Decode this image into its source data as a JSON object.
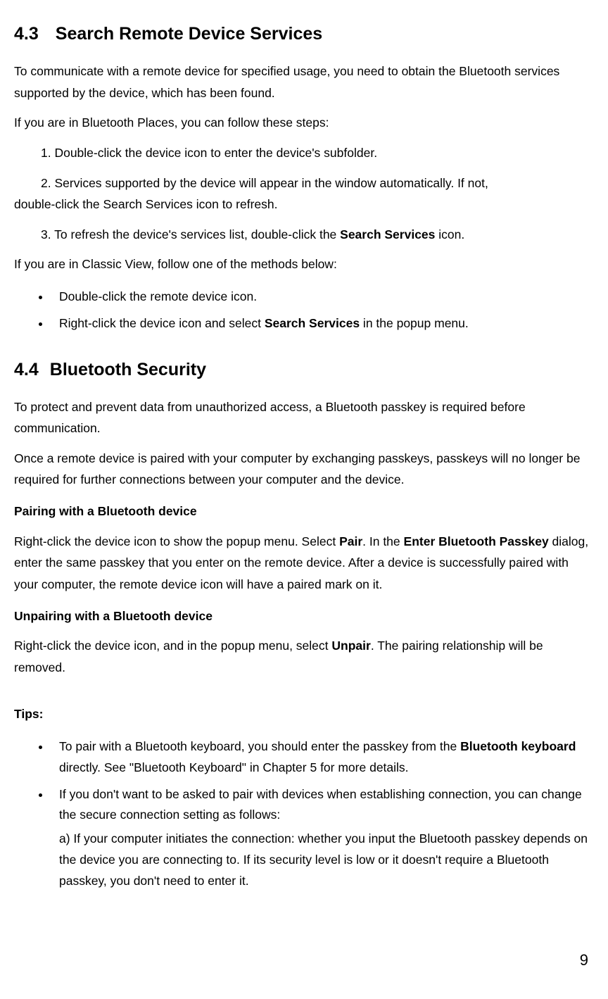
{
  "section43": {
    "number": "4.3",
    "title": "Search Remote Device Services",
    "para1": "To communicate with a remote device for specified usage, you need to obtain the Bluetooth services supported by the device, which has been found.",
    "para2": "If you are in Bluetooth Places, you can follow these steps:",
    "step1": "1. Double-click the device icon to enter the device's subfolder.",
    "step2a": "2. Services supported by the device will appear in the window automatically. If not,",
    "step2b": "double-click the Search Services icon to refresh.",
    "step3_pre": "3. To refresh the device's services list, double-click the ",
    "step3_bold": "Search Services",
    "step3_post": " icon.",
    "para3": "If you are in Classic View, follow one of the methods below:",
    "bullet1": "Double-click the remote device icon.",
    "bullet2_pre": "Right-click the device icon and select ",
    "bullet2_bold": "Search Services",
    "bullet2_post": " in the popup menu."
  },
  "section44": {
    "number": "4.4",
    "title": "Bluetooth Security",
    "para1": "To protect and prevent data from unauthorized access, a Bluetooth passkey is required before communication.",
    "para2": "Once a remote device is paired with your computer by exchanging passkeys, passkeys will no longer be required for further connections between your computer and the device.",
    "subhead1": "Pairing with a Bluetooth device",
    "p3_t1": "Right-click the device icon to show the popup menu. Select ",
    "p3_b1": "Pair",
    "p3_t2": ". In the ",
    "p3_b2": "Enter Bluetooth Passkey",
    "p3_t3": " dialog, enter the same passkey that you enter on the remote device. After a device is successfully paired with your computer, the remote device icon will have a paired mark on it.",
    "subhead2": "Unpairing with a Bluetooth device",
    "p4_t1": "Right-click the device icon, and in the popup menu, select ",
    "p4_b1": "Unpair",
    "p4_t2": ". The pairing relationship will be removed.",
    "tips_label": "Tips:",
    "tip1_t1": "To pair with a Bluetooth keyboard, you should enter the passkey from the ",
    "tip1_b1": "Bluetooth keyboard",
    "tip1_t2": " directly. See \"Bluetooth Keyboard\" in Chapter 5 for more details.",
    "tip2_t1": "If you don't want to be asked to pair with devices when establishing connection, you can change the secure connection setting as follows:",
    "tip2_a": "a) If your computer initiates the connection: whether you input the Bluetooth passkey depends on the device you are connecting to. If its security level is low or it doesn't require a Bluetooth passkey, you don't need to enter it."
  },
  "page_number": "9"
}
